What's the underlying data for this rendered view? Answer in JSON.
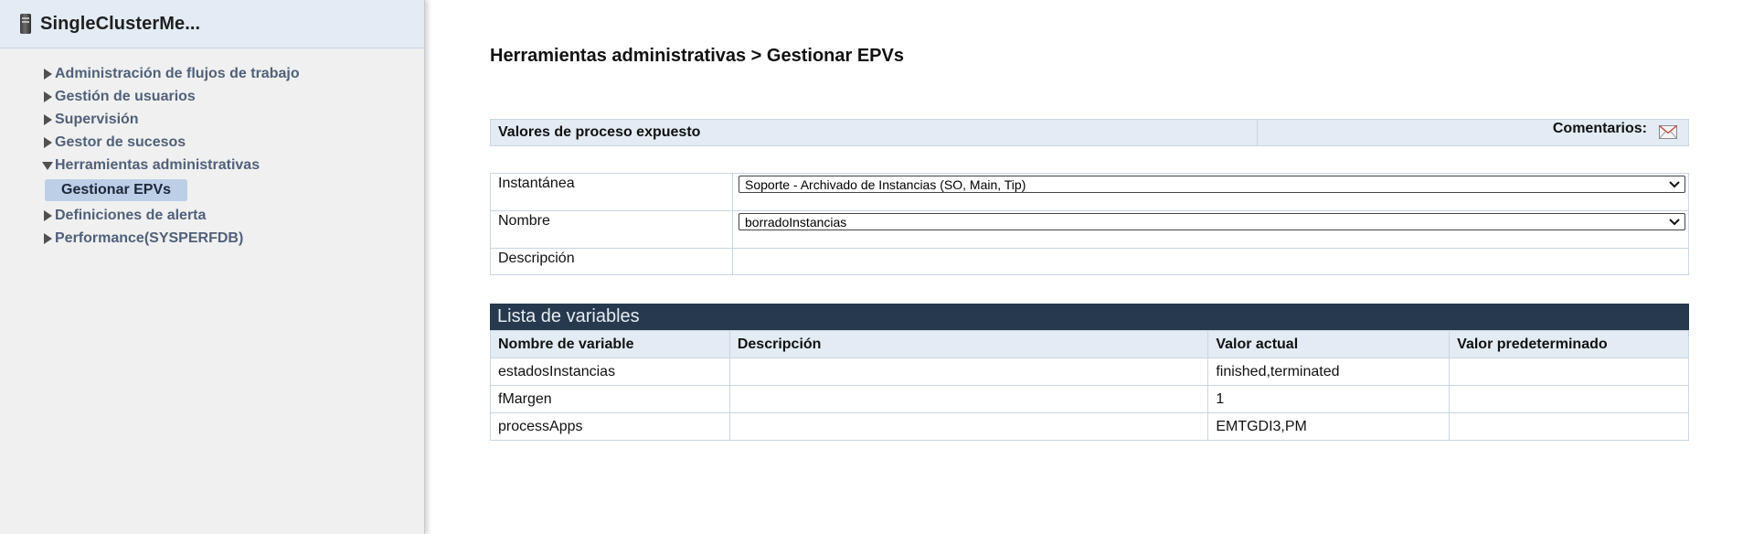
{
  "sidebar": {
    "title": "SingleClusterMe...",
    "items": [
      {
        "label": "Administración de flujos de trabajo",
        "expanded": false
      },
      {
        "label": "Gestión de usuarios",
        "expanded": false
      },
      {
        "label": "Supervisión",
        "expanded": false
      },
      {
        "label": "Gestor de sucesos",
        "expanded": false
      },
      {
        "label": "Herramientas administrativas",
        "expanded": true,
        "children": [
          {
            "label": "Gestionar EPVs",
            "selected": true
          }
        ]
      },
      {
        "label": "Definiciones de alerta",
        "expanded": false
      },
      {
        "label": "Performance(SYSPERFDB)",
        "expanded": false
      }
    ]
  },
  "main": {
    "breadcrumb": "Herramientas administrativas > Gestionar EPVs",
    "section_title": "Valores de proceso expuesto",
    "comments_label": "Comentarios:",
    "form": {
      "snapshot_label": "Instantánea",
      "snapshot_value": "Soporte - Archivado de Instancias (SO, Main, Tip)",
      "name_label": "Nombre",
      "name_value": "borradoInstancias",
      "description_label": "Descripción",
      "description_value": ""
    },
    "variables": {
      "title": "Lista de variables",
      "columns": [
        "Nombre de variable",
        "Descripción",
        "Valor actual",
        "Valor predeterminado"
      ],
      "rows": [
        [
          "estadosInstancias",
          "",
          "finished,terminated",
          ""
        ],
        [
          "fMargen",
          "",
          "1",
          ""
        ],
        [
          "processApps",
          "",
          "EMTGDI3,PM",
          ""
        ]
      ]
    }
  },
  "icons": {
    "server": "server-icon",
    "expand": "triangle-right-icon",
    "collapse": "triangle-down-icon",
    "mail": "envelope-icon",
    "dropdown": "chevron-down-icon"
  },
  "colors": {
    "sidebar_bg": "#f0f0f0",
    "sidebar_header_bg": "#e3ebf5",
    "selected_item_bg": "#bccfe7",
    "nav_text": "#51607a",
    "table_header_bg": "#e3ebf4",
    "variables_title_bg": "#26394d"
  }
}
